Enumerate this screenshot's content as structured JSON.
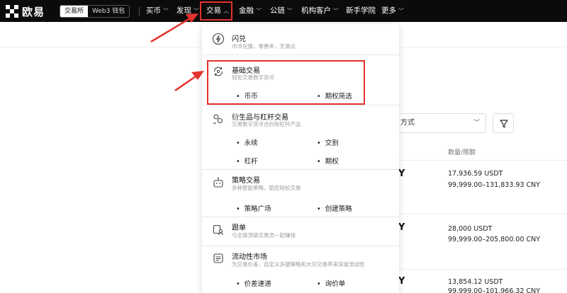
{
  "brand": {
    "name": "欧易"
  },
  "mode_switch": {
    "exchange": "交易所",
    "web3": "Web3 钱包"
  },
  "nav": {
    "buy": "买币",
    "discover": "发现",
    "trade": "交易",
    "finance": "金融",
    "chain": "公链",
    "institutional": "机构客户",
    "academy": "新手学院",
    "more": "更多"
  },
  "menu": {
    "flash": {
      "title": "闪兑",
      "desc": "币币兑换，零费率，无滑点"
    },
    "basic": {
      "title": "基础交易",
      "desc": "轻松交易数字货币",
      "subs": [
        "币币",
        "期权简选"
      ]
    },
    "derivatives": {
      "title": "衍生品与杠杆交易",
      "desc": "交易数字货币合约和杠杆产品",
      "subs": [
        "永续",
        "交割",
        "杠杆",
        "期权"
      ]
    },
    "strategy": {
      "title": "策略交易",
      "desc": "多种智能策略，助您轻松交易",
      "subs": [
        "策略广场",
        "创建策略"
      ]
    },
    "copy": {
      "title": "跟单",
      "desc": "与全球顶级交易员一起赚钱"
    },
    "liquidity": {
      "title": "流动性市场",
      "desc": "为交易价差、自定义多腿策略和大宗交易带来深度流动性",
      "subs": [
        "价差速递",
        "询价单"
      ]
    }
  },
  "background": {
    "select_label": "方式",
    "col_header": "数量/限额",
    "rows": [
      {
        "currency": "Y",
        "qty": "17,936.59 USDT",
        "range": "99,999.00–131,833.93 CNY"
      },
      {
        "currency": "Y",
        "qty": "28,000 USDT",
        "range": "99,999.00–205,800.00 CNY"
      },
      {
        "currency": "Y",
        "qty": "13,854.12 USDT",
        "range": "99,999.00–101,966.32 CNY"
      }
    ]
  },
  "colors": {
    "annotation_red": "#e5322d",
    "nav_bg": "#0b0b0b"
  }
}
